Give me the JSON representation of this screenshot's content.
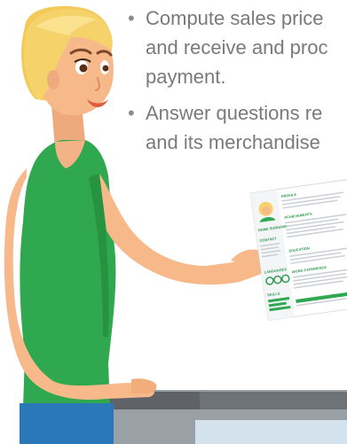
{
  "bullets": [
    {
      "lines": [
        "Compute sales price",
        "and receive and proc",
        "payment."
      ]
    },
    {
      "lines": [
        "Answer questions re",
        "and its merchandise"
      ]
    }
  ],
  "resume": {
    "name": "NAME SURNAME",
    "profile": "PROFILE",
    "achievements": "ACHIEVEMENTS",
    "contact": "CONTACT",
    "education": "EDUCATION",
    "languages": "LANGUAGES",
    "work_experience": "WORK EXPERIENCE",
    "skills": "SKILLS"
  },
  "colors": {
    "shirt": "#2fa84f",
    "hair": "#f6cf62",
    "skin": "#f7b98a",
    "counter": "#8a9196",
    "resume_accent": "#2f9a52"
  }
}
